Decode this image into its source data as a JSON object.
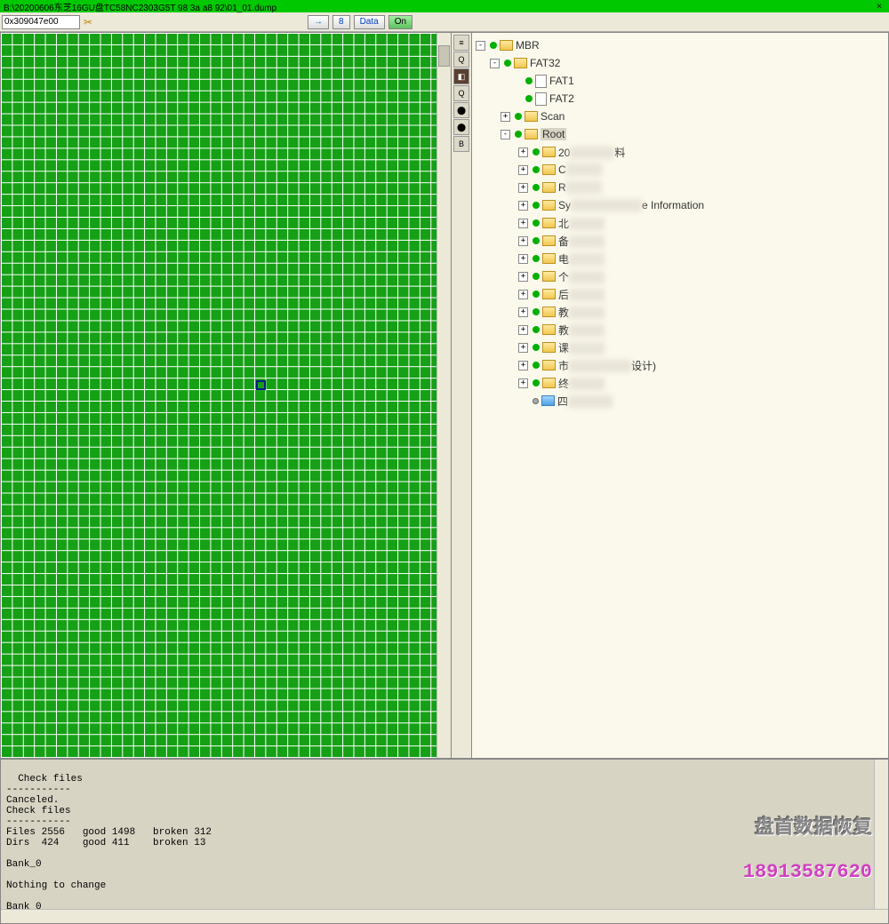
{
  "titlebar": {
    "path": "B:\\20200606东芝16GU盘TC58NC2303G5T  98 3a a8 92\\01_01.dump",
    "close": "×"
  },
  "toolbar": {
    "address": "0x309047e00",
    "zoom": "8",
    "data_label": "Data",
    "on_label": "On"
  },
  "mid_tools": [
    "≡",
    "Q",
    "◧",
    "Q",
    "⬤",
    "⬤",
    "B"
  ],
  "tree": {
    "root": "MBR",
    "fat32": "FAT32",
    "fat1": "FAT1",
    "fat2": "FAT2",
    "scan": "Scan",
    "root_folder": "Root",
    "items": [
      {
        "pre": "20",
        "post": "料"
      },
      {
        "pre": "C",
        "post": ""
      },
      {
        "pre": "R",
        "post": ""
      },
      {
        "pre": "Sy",
        "post": "e Information"
      },
      {
        "pre": "北",
        "post": ""
      },
      {
        "pre": "备",
        "post": ""
      },
      {
        "pre": "电",
        "post": ""
      },
      {
        "pre": "个",
        "post": ""
      },
      {
        "pre": "后",
        "post": ""
      },
      {
        "pre": "教",
        "post": ""
      },
      {
        "pre": "教",
        "post": ""
      },
      {
        "pre": "课",
        "post": ""
      },
      {
        "pre": "市",
        "post": "设计)"
      },
      {
        "pre": "终",
        "post": ""
      }
    ],
    "last_item_pre": "四"
  },
  "console": {
    "lines": "Check files\n-----------\nCanceled.\nCheck files\n-----------\nFiles 2556   good 1498   broken 312\nDirs  424    good 411    broken 13\n\nBank_0\n\nNothing to change\n\nBank_0"
  },
  "watermark": {
    "line1": "盘首数据恢复",
    "line2": "18913587620"
  }
}
